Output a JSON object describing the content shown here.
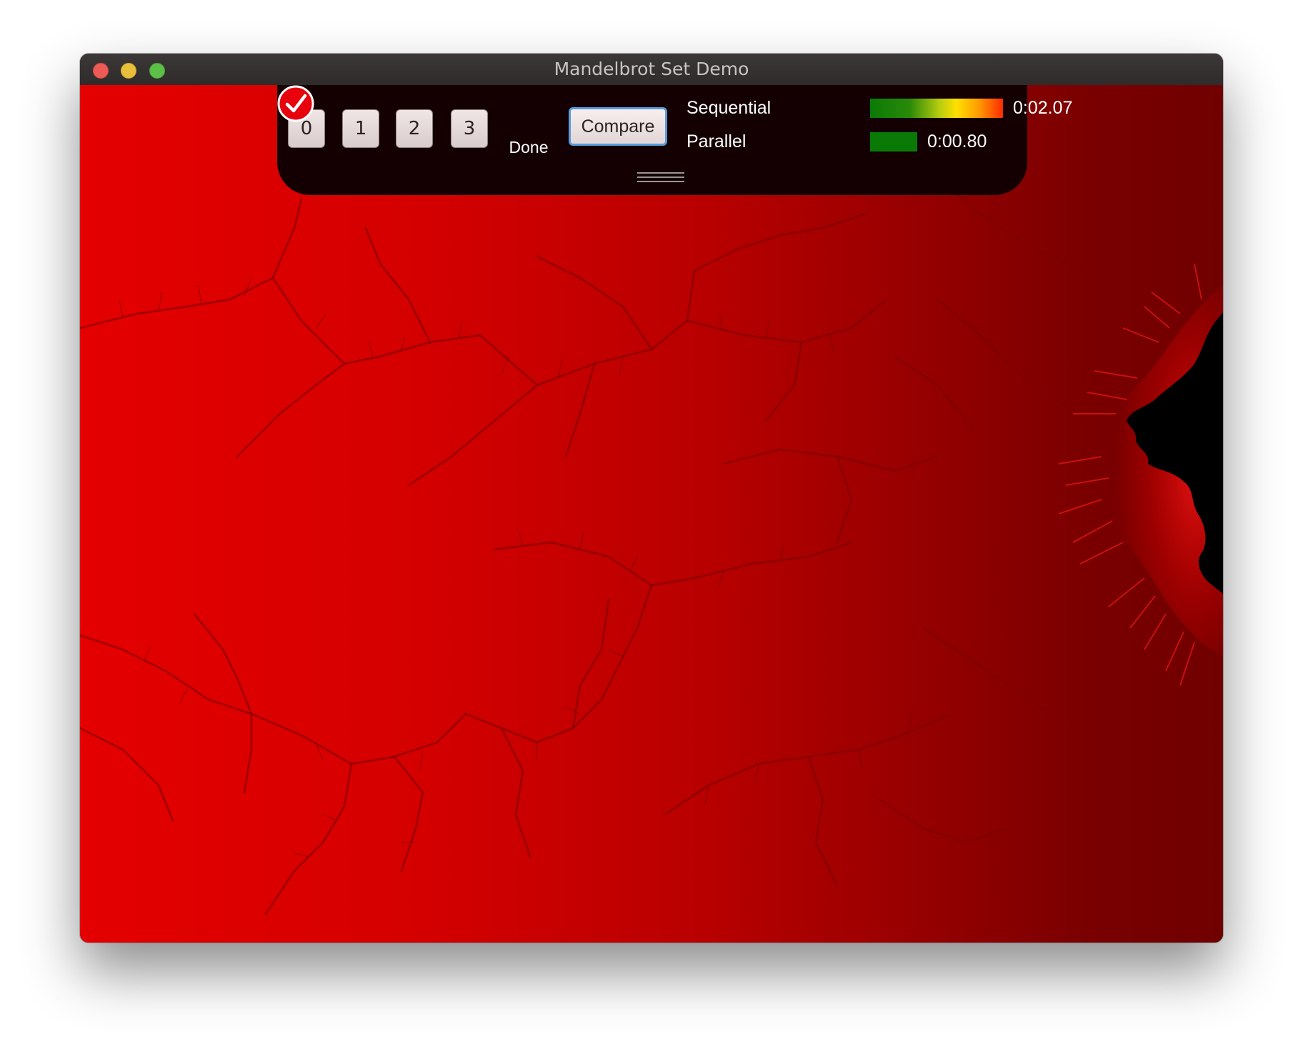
{
  "window": {
    "title": "Mandelbrot Set Demo"
  },
  "toolbar": {
    "buttons": [
      "0",
      "1",
      "2",
      "3"
    ],
    "status_label": "Done",
    "compare_label": "Compare"
  },
  "timings": {
    "sequential": {
      "label": "Sequential",
      "time": "0:02.07",
      "bar_relative": 1.0,
      "bar_colors": [
        "#0a7a07",
        "#ffe000",
        "#ff2a00"
      ]
    },
    "parallel": {
      "label": "Parallel",
      "time": "0:00.80",
      "bar_relative": 0.355,
      "bar_colors": [
        "#0a7a07"
      ]
    }
  },
  "colors": {
    "fractal_red": "#e40000",
    "fractal_dark": "#700000",
    "panel_bg": "#140003",
    "status_ok": "#e8000c"
  }
}
